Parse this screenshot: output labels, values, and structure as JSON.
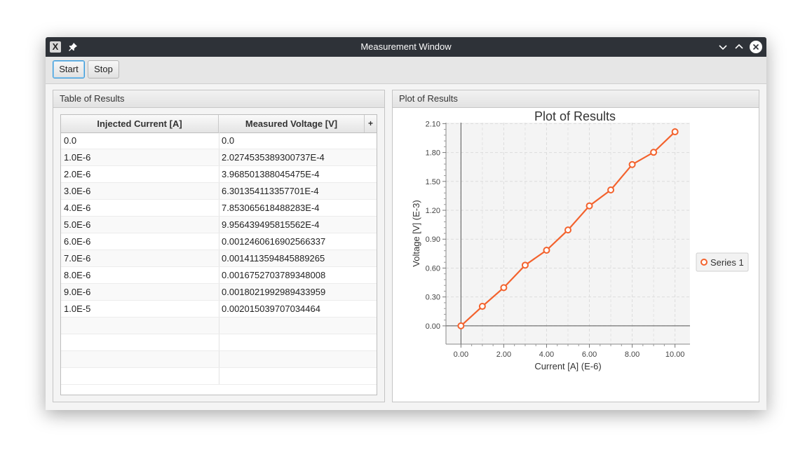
{
  "window": {
    "title": "Measurement Window"
  },
  "toolbar": {
    "start_label": "Start",
    "stop_label": "Stop"
  },
  "table_panel": {
    "header": "Table of Results",
    "columns": [
      "Injected Current [A]",
      "Measured Voltage [V]"
    ],
    "column_menu_glyph": "+",
    "rows": [
      [
        "0.0",
        "0.0"
      ],
      [
        "1.0E-6",
        "2.0274535389300737E-4"
      ],
      [
        "2.0E-6",
        "3.968501388045475E-4"
      ],
      [
        "3.0E-6",
        "6.301354113357701E-4"
      ],
      [
        "4.0E-6",
        "7.853065618488283E-4"
      ],
      [
        "5.0E-6",
        "9.956439495815562E-4"
      ],
      [
        "6.0E-6",
        "0.0012460616902566337"
      ],
      [
        "7.0E-6",
        "0.0014113594845889265"
      ],
      [
        "8.0E-6",
        "0.0016752703789348008"
      ],
      [
        "9.0E-6",
        "0.0018021992989433959"
      ],
      [
        "1.0E-5",
        "0.002015039707034464"
      ]
    ]
  },
  "plot_panel": {
    "header": "Plot of Results"
  },
  "colors": {
    "series": "#f3622d",
    "titlebar": "#2e3238",
    "focus": "#3a9ad9"
  },
  "chart_data": {
    "type": "line",
    "title": "Plot of Results",
    "xlabel": "Current [A] (E-6)",
    "ylabel": "Voltage [V] (E-3)",
    "xlim": [
      -0.7,
      10.7
    ],
    "ylim": [
      -0.19,
      2.11
    ],
    "xticks": [
      "0.00",
      "2.00",
      "4.00",
      "6.00",
      "8.00",
      "10.00"
    ],
    "yticks": [
      "0.00",
      "0.30",
      "0.60",
      "0.90",
      "1.20",
      "1.50",
      "1.80",
      "2.10"
    ],
    "grid": true,
    "legend_position": "right",
    "series": [
      {
        "name": "Series 1",
        "x": [
          0,
          1,
          2,
          3,
          4,
          5,
          6,
          7,
          8,
          9,
          10
        ],
        "y": [
          0.0,
          0.2027,
          0.3969,
          0.6301,
          0.7853,
          0.9956,
          1.2461,
          1.4114,
          1.6753,
          1.8022,
          2.015
        ]
      }
    ]
  }
}
